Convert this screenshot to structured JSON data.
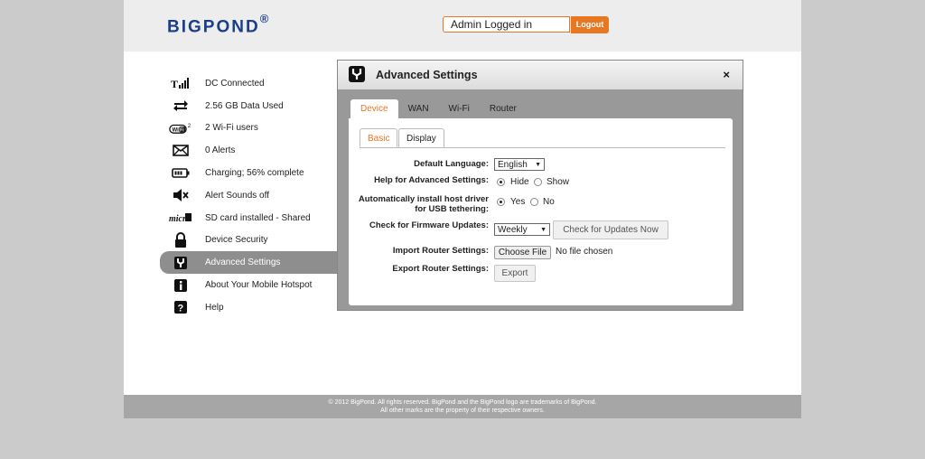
{
  "header": {
    "logo_text": "BIGPOND",
    "logo_mark": "®",
    "login_status": "Admin Logged in",
    "logout_label": "Logout"
  },
  "sidebar": {
    "items": [
      {
        "label": "DC Connected",
        "icon": "signal-icon"
      },
      {
        "label": "2.56 GB Data Used",
        "icon": "transfer-arrows-icon"
      },
      {
        "label": "2 Wi-Fi users",
        "icon": "wifi-icon"
      },
      {
        "label": "0 Alerts",
        "icon": "envelope-icon"
      },
      {
        "label": "Charging; 56% complete",
        "icon": "battery-icon"
      },
      {
        "label": "Alert Sounds off",
        "icon": "speaker-muted-icon"
      },
      {
        "label": "SD card installed - Shared",
        "icon": "sd-card-icon"
      },
      {
        "label": "Device Security",
        "icon": "lock-icon"
      },
      {
        "label": "Advanced Settings",
        "icon": "wrench-icon"
      },
      {
        "label": "About Your Mobile Hotspot",
        "icon": "info-icon"
      },
      {
        "label": "Help",
        "icon": "question-icon"
      }
    ],
    "active_index": 8
  },
  "panel": {
    "title": "Advanced Settings",
    "close": "×",
    "tabs": [
      "Device",
      "WAN",
      "Wi-Fi",
      "Router"
    ],
    "active_tab": "Device",
    "subtabs": [
      "Basic",
      "Display"
    ],
    "active_subtab": "Basic",
    "form": {
      "language_label": "Default Language:",
      "language_value": "English",
      "help_label": "Help for Advanced Settings:",
      "help_hide": "Hide",
      "help_show": "Show",
      "help_selected": "Hide",
      "usb_label_line1": "Automatically install host driver",
      "usb_label_line2": "for USB tethering:",
      "usb_yes": "Yes",
      "usb_no": "No",
      "usb_selected": "Yes",
      "firmware_label": "Check for Firmware Updates:",
      "firmware_value": "Weekly",
      "check_updates_button": "Check for Updates Now",
      "import_label": "Import Router Settings:",
      "choose_file_button": "Choose File",
      "no_file_text": "No file chosen",
      "export_label": "Export Router Settings:",
      "export_button": "Export"
    }
  },
  "footer": {
    "line1": "© 2012 BigPond. All rights reserved. BigPond and the BigPond logo are trademarks of BigPond.",
    "line2": "All other marks are the property of their respective owners."
  },
  "colors": {
    "accent": "#e87722",
    "brand": "#1b3e8a",
    "panel_gray": "#999999"
  }
}
